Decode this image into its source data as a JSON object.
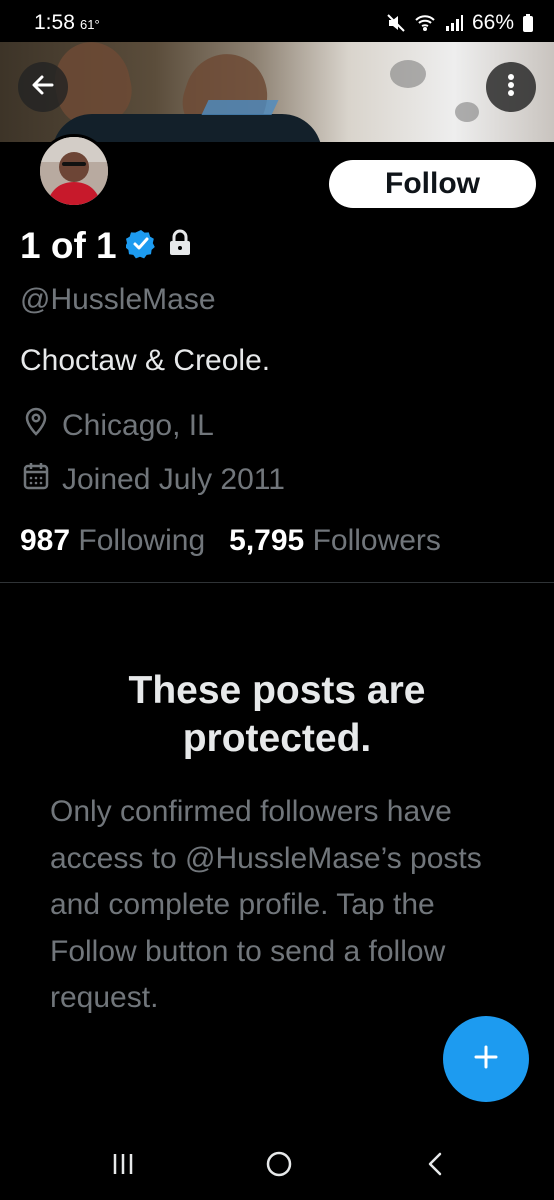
{
  "status_bar": {
    "time": "1:58",
    "temperature": "61°",
    "battery": "66%"
  },
  "header": {
    "back_icon": "arrow-left-icon",
    "more_icon": "more-vertical-icon"
  },
  "profile": {
    "display_name": "1 of 1",
    "verified_icon": "verified-badge-icon",
    "protected_icon": "lock-icon",
    "handle": "@HussleMase",
    "bio": "Choctaw & Creole.",
    "location": "Chicago, IL",
    "joined": "Joined July 2011",
    "following_count": "987",
    "following_label": "Following",
    "followers_count": "5,795",
    "followers_label": "Followers",
    "follow_button_label": "Follow"
  },
  "protected_notice": {
    "title": "These posts are protected.",
    "body": "Only confirmed followers have access to @HussleMase’s posts and complete profile. Tap the Follow button to send a follow request."
  },
  "colors": {
    "background": "#000000",
    "accent": "#1d9bf0",
    "secondary_text": "#71767b",
    "primary_text": "#e7e9ea"
  },
  "navigation": {
    "recent_apps_icon": "recent-apps-icon",
    "home_icon": "home-circle-icon",
    "back_icon": "system-back-icon"
  }
}
